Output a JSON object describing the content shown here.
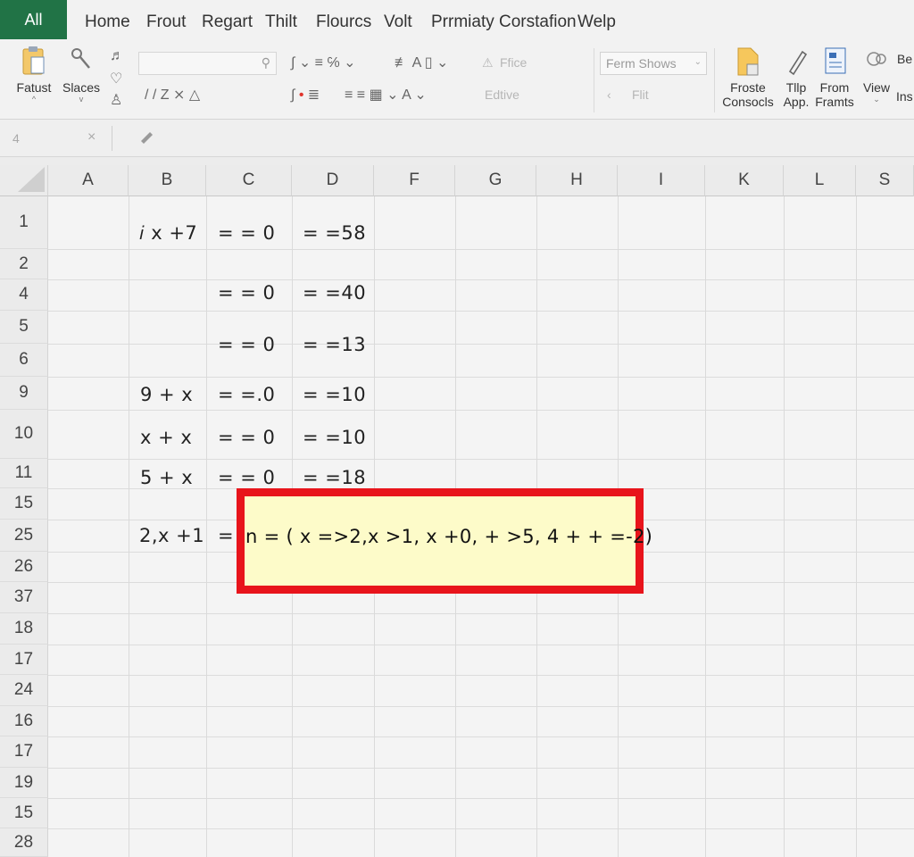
{
  "menu": {
    "file_tab": "All",
    "tabs": [
      "Home",
      "Frout",
      "Regart",
      "Thilt",
      "Flourcs",
      "Volt",
      "Prrmiaty Corstafion",
      "Welp"
    ]
  },
  "ribbon": {
    "group1": {
      "label": "Fatust"
    },
    "group2": {
      "label": "Slaces"
    },
    "font_name_faded": "Ffice",
    "editing_faded": "Edtive",
    "filter_faded": "Flit",
    "style_dropdown": "Ferm Shows",
    "right_groups": [
      {
        "line1": "Froste",
        "line2": "Consocls"
      },
      {
        "line1": "Tllp",
        "line2": "App."
      },
      {
        "line1": "From",
        "line2": "Framts"
      },
      {
        "line1": "View",
        "line2": ""
      },
      {
        "line1": "Ins",
        "line2": ""
      },
      {
        "line1": "Be",
        "line2": ""
      }
    ]
  },
  "formula_bar": {
    "name_box": "4"
  },
  "grid": {
    "columns": [
      "A",
      "B",
      "C",
      "D",
      "F",
      "G",
      "H",
      "I",
      "K",
      "L",
      "S"
    ],
    "rows": [
      "1",
      "2",
      "4",
      "5",
      "6",
      "9",
      "10",
      "11",
      "15",
      "25",
      "26",
      "37",
      "18",
      "17",
      "24",
      "16",
      "17",
      "19",
      "15",
      "28"
    ],
    "cells": {
      "b1": "𝑖 x +7",
      "c1": "= = 0",
      "d1": "= =58",
      "c4": "= = 0",
      "d4": "= =40",
      "c6": "= = 0",
      "d6": "= =13",
      "b9": "9 + x",
      "c9": "= =.0",
      "d9": "= =10",
      "b10": "x + x",
      "c10": "= = 0",
      "d10": "= =10",
      "b11": "5 + x",
      "c11": "= = 0",
      "d11": "= =18",
      "b25": "2,x +1",
      "c25": "="
    },
    "highlight": {
      "text": "n = ( x =>2,x >1, x +0, + >5, 4 + + =-2)",
      "border_color": "#e8141b",
      "fill_color": "#fdfbc9"
    }
  },
  "colors": {
    "file_tab": "#217346",
    "background": "#ececec"
  }
}
